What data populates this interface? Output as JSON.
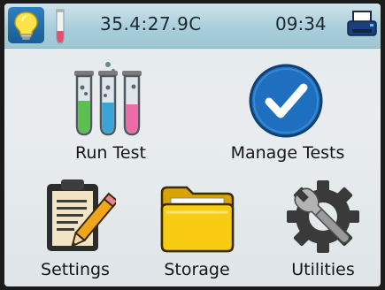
{
  "status_bar": {
    "sensor_reading": "35.4:27.9C",
    "time": "09:34",
    "icons": [
      "lightbulb-icon",
      "test-tube-icon",
      "printer-icon"
    ]
  },
  "menu": {
    "run_test": "Run Test",
    "manage_tests": "Manage Tests",
    "settings": "Settings",
    "storage": "Storage",
    "utilities": "Utilities"
  },
  "colors": {
    "top_bar": "#a9cedb",
    "bulb_button": "#1f6aa8",
    "check_circle": "#1e6fbf",
    "folder": "#f5c400"
  }
}
